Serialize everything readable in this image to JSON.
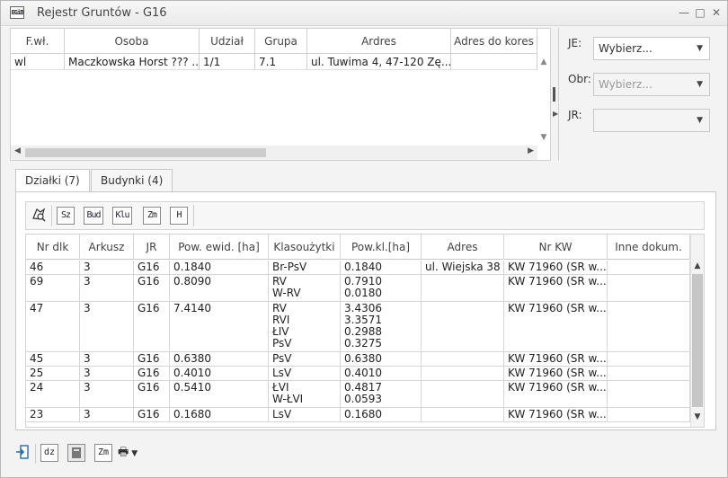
{
  "window": {
    "title": "Rejestr Gruntów - G16",
    "app_icon_text": "EGiB"
  },
  "owners": {
    "columns": [
      "F.wł.",
      "Osoba",
      "Udział",
      "Grupa",
      "Ardres",
      "Adres do kores"
    ],
    "rows": [
      [
        "wl",
        "Maczkowska Horst ??? ...",
        "1/1",
        "7.1",
        "ul. Tuwima 4, 47-120 Zę...",
        ""
      ]
    ]
  },
  "filters": {
    "je": {
      "label": "JE:",
      "value": "Wybierz..."
    },
    "obr": {
      "label": "Obr:",
      "value": "Wybierz..."
    },
    "jr": {
      "label": "JR:",
      "value": ""
    }
  },
  "tabs": [
    {
      "label": "Działki (7)",
      "active": true
    },
    {
      "label": "Budynki (4)",
      "active": false
    }
  ],
  "toolbar": {
    "buttons": [
      {
        "icon": "map-search-icon",
        "text": ""
      },
      {
        "icon": "sz-icon",
        "text": "Sz"
      },
      {
        "icon": "bud-icon",
        "text": "Bud"
      },
      {
        "icon": "klu-icon",
        "text": "Klu"
      },
      {
        "icon": "zm-icon",
        "text": "Zm"
      },
      {
        "icon": "h-icon",
        "text": "H"
      }
    ]
  },
  "parcels": {
    "columns": [
      "Nr dlk",
      "Arkusz",
      "JR",
      "Pow. ewid. [ha]",
      "Klasoużytki",
      "Pow.kl.[ha]",
      "Adres",
      "Nr KW",
      "Inne dokum."
    ],
    "rows": [
      {
        "nr": "46",
        "arkusz": "3",
        "jr": "G16",
        "pow": "0.1840",
        "klas": [
          "Br-PsV"
        ],
        "powkl": [
          "0.1840"
        ],
        "adres": "ul. Wiejska 38",
        "kw": "KW 71960 (SR w...",
        "inne": ""
      },
      {
        "nr": "69",
        "arkusz": "3",
        "jr": "G16",
        "pow": "0.8090",
        "klas": [
          "RV",
          "W-RV"
        ],
        "powkl": [
          "0.7910",
          "0.0180"
        ],
        "adres": "",
        "kw": "KW 71960 (SR w...",
        "inne": ""
      },
      {
        "nr": "47",
        "arkusz": "3",
        "jr": "G16",
        "pow": "7.4140",
        "klas": [
          "RV",
          "RVI",
          "ŁIV",
          "PsV"
        ],
        "powkl": [
          "3.4306",
          "3.3571",
          "0.2988",
          "0.3275"
        ],
        "adres": "",
        "kw": "KW 71960 (SR w...",
        "inne": ""
      },
      {
        "nr": "45",
        "arkusz": "3",
        "jr": "G16",
        "pow": "0.6380",
        "klas": [
          "PsV"
        ],
        "powkl": [
          "0.6380"
        ],
        "adres": "",
        "kw": "KW 71960 (SR w...",
        "inne": ""
      },
      {
        "nr": "25",
        "arkusz": "3",
        "jr": "G16",
        "pow": "0.4010",
        "klas": [
          "LsV"
        ],
        "powkl": [
          "0.4010"
        ],
        "adres": "",
        "kw": "KW 71960 (SR w...",
        "inne": ""
      },
      {
        "nr": "24",
        "arkusz": "3",
        "jr": "G16",
        "pow": "0.5410",
        "klas": [
          "ŁVI",
          "W-ŁVI"
        ],
        "powkl": [
          "0.4817",
          "0.0593"
        ],
        "adres": "",
        "kw": "KW 71960 (SR w...",
        "inne": ""
      },
      {
        "nr": "23",
        "arkusz": "3",
        "jr": "G16",
        "pow": "0.1680",
        "klas": [
          "LsV"
        ],
        "powkl": [
          "0.1680"
        ],
        "adres": "",
        "kw": "KW 71960 (SR w...",
        "inne": ""
      }
    ]
  },
  "bottom_toolbar": {
    "buttons": [
      {
        "icon": "exit-icon",
        "text": ""
      },
      {
        "icon": "dz-icon",
        "text": "dz"
      },
      {
        "icon": "document-icon",
        "text": ""
      },
      {
        "icon": "zm-icon",
        "text": "Zm"
      },
      {
        "icon": "print-icon",
        "text": ""
      }
    ]
  }
}
